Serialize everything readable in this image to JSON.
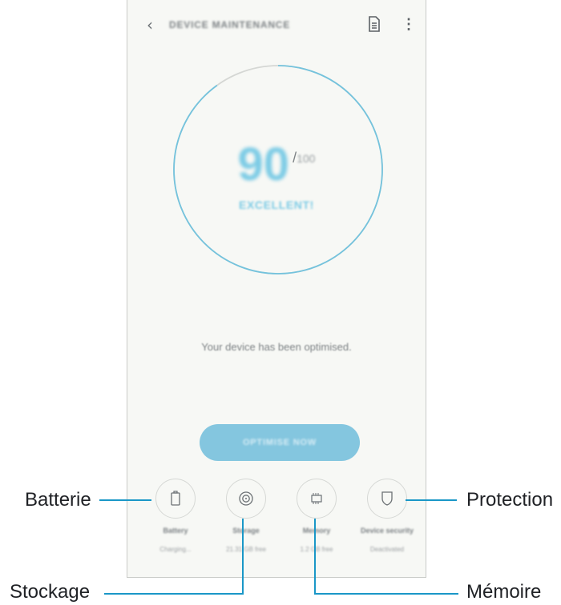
{
  "header": {
    "back_icon": "chevron-left-icon",
    "title": "DEVICE MAINTENANCE",
    "report_icon": "document-icon",
    "more_icon": "more-vert-icon"
  },
  "score": {
    "value": "90",
    "separator": "/",
    "max": "100",
    "status": "EXCELLENT!",
    "fraction": 0.9,
    "accent_color": "#7ccbe5"
  },
  "message": "Your device has been optimised.",
  "optimise_button": {
    "label": "OPTIMISE NOW",
    "color": "#84c6df"
  },
  "tools": [
    {
      "icon": "battery-icon",
      "name": "Battery",
      "value": "Charging..."
    },
    {
      "icon": "storage-icon",
      "name": "Storage",
      "value": "21.31 GB free"
    },
    {
      "icon": "memory-icon",
      "name": "Memory",
      "value": "1.2 GB free"
    },
    {
      "icon": "shield-icon",
      "name": "Device security",
      "value": "Deactivated"
    }
  ],
  "callouts": {
    "battery": "Batterie",
    "storage": "Stockage",
    "memory": "Mémoire",
    "security": "Protection",
    "line_color": "#1a97c7"
  }
}
